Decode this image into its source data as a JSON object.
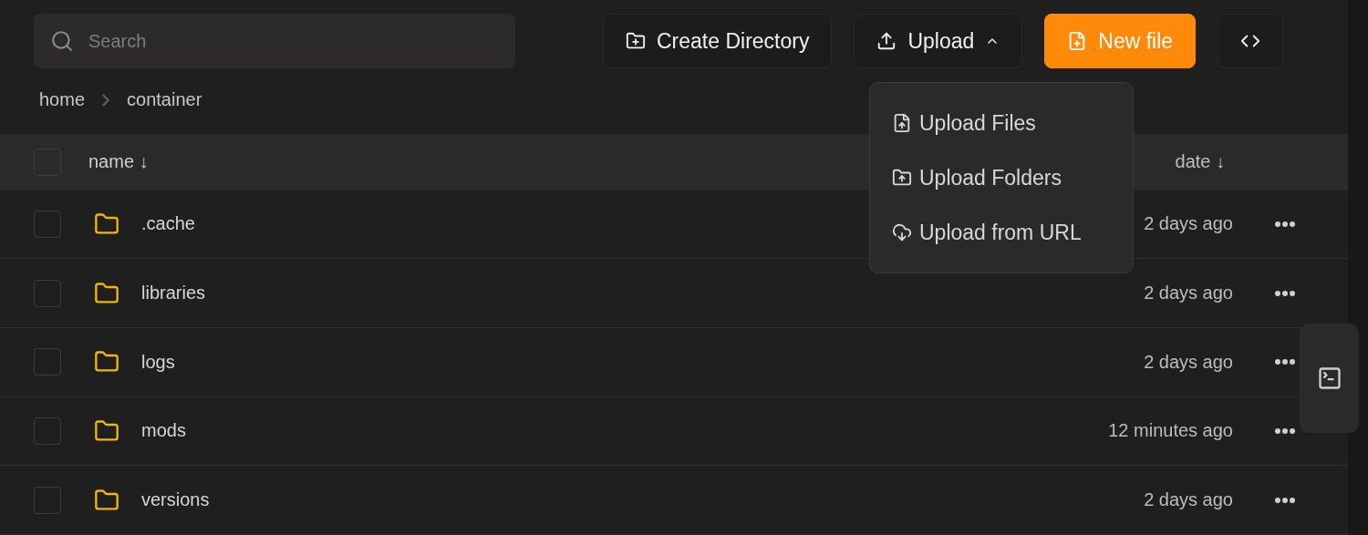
{
  "search": {
    "placeholder": "Search"
  },
  "actions": [
    {
      "kind": "create",
      "label": "Create Directory"
    },
    {
      "kind": "upload",
      "label": "Upload",
      "expanded": true
    },
    {
      "kind": "new",
      "label": "New file"
    },
    {
      "kind": "code"
    }
  ],
  "upload_menu": [
    {
      "kind": "file",
      "label": "Upload Files"
    },
    {
      "kind": "folder",
      "label": "Upload Folders"
    },
    {
      "kind": "url",
      "label": "Upload from URL"
    }
  ],
  "breadcrumb": [
    "home",
    "container"
  ],
  "table": {
    "columns": [
      {
        "label": "name ↓"
      },
      {
        "label": "date ↓"
      }
    ],
    "header_checked": false,
    "rows": [
      {
        "name": ".cache",
        "date": "2 days ago",
        "checked": false
      },
      {
        "name": "libraries",
        "date": "2 days ago",
        "checked": false
      },
      {
        "name": "logs",
        "date": "2 days ago",
        "checked": false
      },
      {
        "name": "mods",
        "date": "12 minutes ago",
        "checked": false
      },
      {
        "name": "versions",
        "date": "2 days ago",
        "checked": false
      }
    ]
  }
}
